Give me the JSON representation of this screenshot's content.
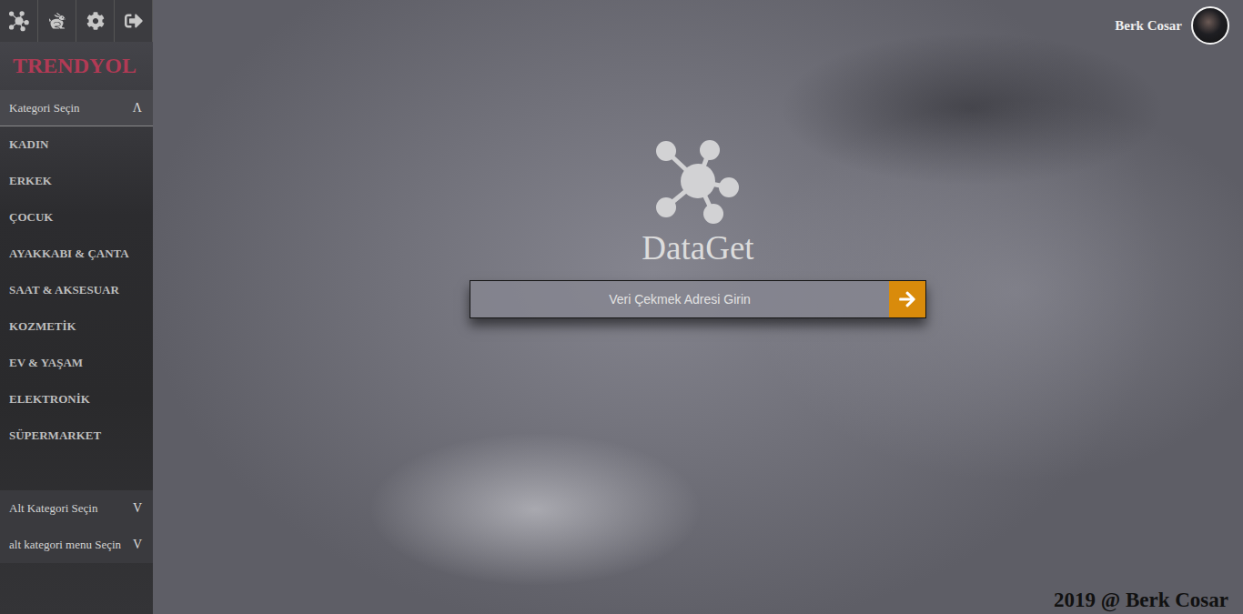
{
  "brand": "TRENDYOL",
  "category_menu": {
    "title": "Kategori Seçin",
    "toggle": "Λ",
    "expanded": true,
    "items": [
      {
        "label": "KADIN",
        "selected": false
      },
      {
        "label": "ERKEK",
        "selected": false
      },
      {
        "label": "ÇOCUK",
        "selected": false
      },
      {
        "label": "AYAKKABI & ÇANTA",
        "selected": false
      },
      {
        "label": "SAAT & AKSESUAR",
        "selected": false
      },
      {
        "label": "KOZMETİK",
        "selected": false
      },
      {
        "label": "EV & YAŞAM",
        "selected": false
      },
      {
        "label": "ELEKTRONİK",
        "selected": false
      },
      {
        "label": "SÜPERMARKET",
        "selected": false
      }
    ]
  },
  "subcategory_menus": [
    {
      "title": "Alt Kategori Seçin",
      "toggle": "V",
      "expanded": false
    },
    {
      "title": "alt kategori menu Seçin",
      "toggle": "V",
      "expanded": false
    }
  ],
  "user": {
    "name": "Berk Cosar"
  },
  "app": {
    "title": "DataGet"
  },
  "search": {
    "placeholder": "Veri Çekmek Adresi Girin"
  },
  "footer": "2019 @ Berk Cosar"
}
